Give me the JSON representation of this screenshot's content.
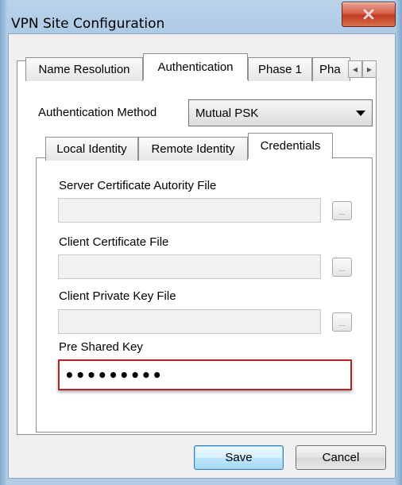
{
  "window": {
    "title": "VPN Site Configuration"
  },
  "tabs": [
    {
      "label": "Name Resolution"
    },
    {
      "label": "Authentication"
    },
    {
      "label": "Phase 1"
    },
    {
      "label": "Pha"
    }
  ],
  "authentication": {
    "method_label": "Authentication Method",
    "method_value": "Mutual PSK"
  },
  "inner_tabs": [
    {
      "label": "Local Identity"
    },
    {
      "label": "Remote Identity"
    },
    {
      "label": "Credentials"
    }
  ],
  "fields": {
    "server_cert": {
      "label": "Server Certificate Autority File",
      "value": ""
    },
    "client_cert": {
      "label": "Client Certificate File",
      "value": ""
    },
    "client_key": {
      "label": "Client Private Key File",
      "value": ""
    },
    "psk": {
      "label": "Pre Shared Key",
      "value": "•••••••••"
    }
  },
  "browse_label": "...",
  "buttons": {
    "save": "Save",
    "cancel": "Cancel"
  },
  "colors": {
    "highlight_border": "#b0262b",
    "close_button": "#c23b22"
  },
  "icons": {
    "close": "close-icon",
    "scroll_left": "arrow-left-icon",
    "scroll_right": "arrow-right-icon",
    "dropdown": "chevron-down-icon"
  }
}
